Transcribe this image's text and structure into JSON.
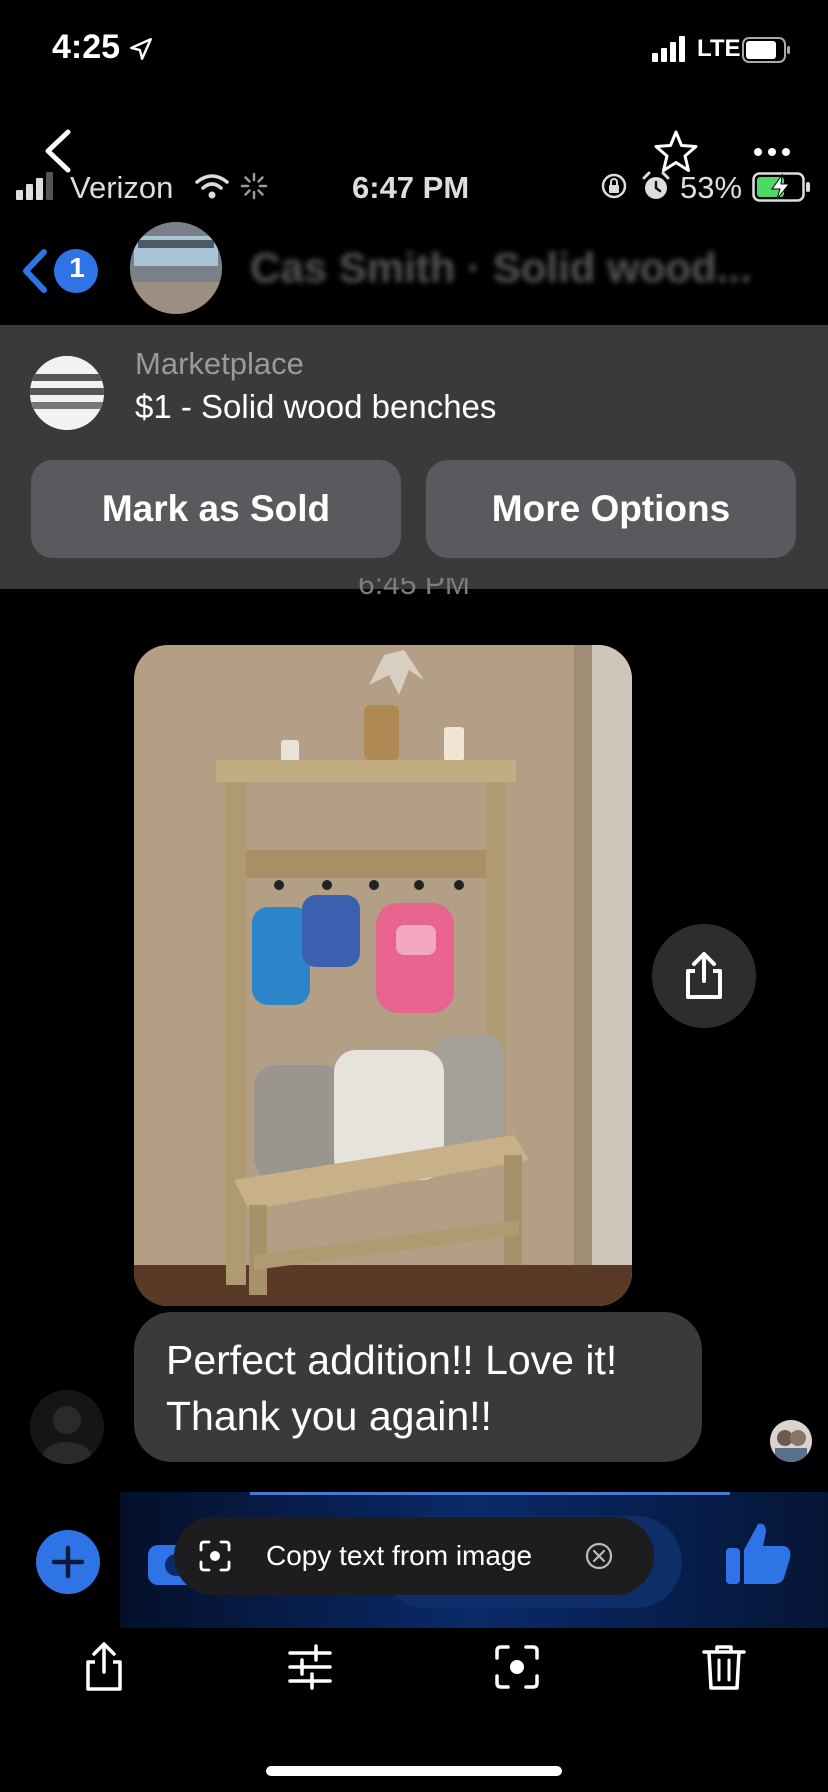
{
  "status_bar": {
    "time": "4:25",
    "network": "LTE",
    "icons": [
      "location-arrow-icon",
      "signal-icon",
      "battery-icon"
    ]
  },
  "viewer_toolbar": {
    "icons": [
      "back-chevron-icon",
      "star-icon",
      "more-icon"
    ]
  },
  "inner_status_bar": {
    "carrier": "Verizon",
    "time": "6:47 PM",
    "battery_percent": "53%",
    "icons": [
      "signal-icon",
      "wifi-icon",
      "spinner-icon",
      "rotation-lock-icon",
      "alarm-icon",
      "charging-battery-icon"
    ]
  },
  "conversation_header": {
    "unread_count": "1",
    "title": "Cas Smith · Solid wood..."
  },
  "marketplace_card": {
    "label": "Marketplace",
    "listing": "$1 - Solid wood benches",
    "buttons": [
      "Mark as Sold",
      "More Options"
    ]
  },
  "thread": {
    "timestamp": "6:45 PM",
    "message_text": "Perfect addition!! Love it! Thank you again!!"
  },
  "toast": {
    "label": "Copy text from image",
    "icons": [
      "scan-text-icon",
      "close-circle-icon"
    ]
  },
  "bottom_toolbar": {
    "icons": [
      "share-icon",
      "adjust-icon",
      "scan-icon",
      "trash-icon"
    ]
  },
  "colors": {
    "background": "#000000",
    "card": "#3a3a3c",
    "button": "#5a5a5e",
    "messenger_blue": "#2f74e6",
    "bubble": "#3a3a3c"
  }
}
